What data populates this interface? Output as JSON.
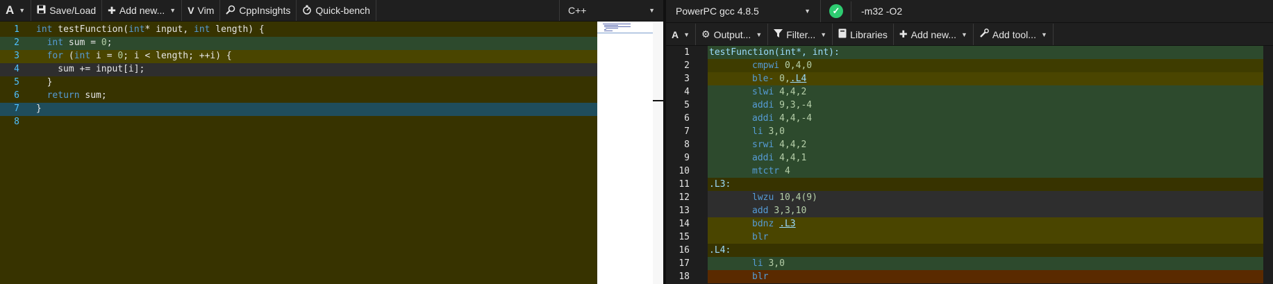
{
  "left_toolbar": {
    "font_label": "A",
    "save_label": "Save/Load",
    "add_new_label": "Add new...",
    "vim_label": "Vim",
    "cppinsights_label": "CppInsights",
    "quickbench_label": "Quick-bench",
    "language": "C++"
  },
  "source": {
    "lines": [
      {
        "n": "1",
        "bg": "#373300"
      },
      {
        "n": "2",
        "bg": "#2d4a2d"
      },
      {
        "n": "3",
        "bg": "#4a4500"
      },
      {
        "n": "4",
        "bg": "#2e2e2e"
      },
      {
        "n": "5",
        "bg": "#373300"
      },
      {
        "n": "6",
        "bg": "#373300"
      },
      {
        "n": "7",
        "bg": "#1f4d5c"
      },
      {
        "n": "8",
        "bg": "#373300"
      }
    ],
    "tokens": {
      "l1_kw1": "int",
      "l1_a": " testFunction(",
      "l1_kw2": "int",
      "l1_b": "* input, ",
      "l1_kw3": "int",
      "l1_c": " length) {",
      "l2_kw": "int",
      "l2_a": " sum = ",
      "l2_num": "0",
      "l2_b": ";",
      "l3_kw1": "for",
      "l3_a": " (",
      "l3_kw2": "int",
      "l3_b": " i = ",
      "l3_num": "0",
      "l3_c": "; i < length; ++i) {",
      "l4": "sum += input[i];",
      "l5": "}",
      "l6_kw": "return",
      "l6_a": " sum;",
      "l7": "}"
    }
  },
  "compiler": {
    "name": "PowerPC gcc 4.8.5",
    "options": "-m32 -O2"
  },
  "right_toolbar": {
    "font_label": "A",
    "output_label": "Output...",
    "filter_label": "Filter...",
    "libraries_label": "Libraries",
    "add_new_label": "Add new...",
    "add_tool_label": "Add tool..."
  },
  "assembly": [
    {
      "n": "1",
      "bg": "#2d4a2d",
      "kind": "func",
      "text": "testFunction(int*, int):"
    },
    {
      "n": "2",
      "bg": "#3e3c00",
      "kind": "ins",
      "op": "cmpwi",
      "args": "0,4,0"
    },
    {
      "n": "3",
      "bg": "#4a4500",
      "kind": "ins",
      "op": "ble-",
      "args": "0,",
      "link": ".L4"
    },
    {
      "n": "4",
      "bg": "#2d4a2d",
      "kind": "ins",
      "op": "slwi",
      "args": "4,4,2"
    },
    {
      "n": "5",
      "bg": "#2d4a2d",
      "kind": "ins",
      "op": "addi",
      "args": "9,3,-4"
    },
    {
      "n": "6",
      "bg": "#2d4a2d",
      "kind": "ins",
      "op": "addi",
      "args": "4,4,-4"
    },
    {
      "n": "7",
      "bg": "#2d4a2d",
      "kind": "ins",
      "op": "li",
      "args": "3,0"
    },
    {
      "n": "8",
      "bg": "#2d4a2d",
      "kind": "ins",
      "op": "srwi",
      "args": "4,4,2"
    },
    {
      "n": "9",
      "bg": "#2d4a2d",
      "kind": "ins",
      "op": "addi",
      "args": "4,4,1"
    },
    {
      "n": "10",
      "bg": "#2d4a2d",
      "kind": "ins",
      "op": "mtctr",
      "args": "4"
    },
    {
      "n": "11",
      "bg": "#373300",
      "kind": "label",
      "text": ".L3:"
    },
    {
      "n": "12",
      "bg": "#2e2e2e",
      "kind": "ins",
      "op": "lwzu",
      "args": "10,4(9)"
    },
    {
      "n": "13",
      "bg": "#2e2e2e",
      "kind": "ins",
      "op": "add",
      "args": "3,3,10"
    },
    {
      "n": "14",
      "bg": "#4a4500",
      "kind": "ins",
      "op": "bdnz",
      "args": "",
      "link": ".L3"
    },
    {
      "n": "15",
      "bg": "#4a4500",
      "kind": "ins",
      "op": "blr",
      "args": ""
    },
    {
      "n": "16",
      "bg": "#373300",
      "kind": "label",
      "text": ".L4:"
    },
    {
      "n": "17",
      "bg": "#2d4a2d",
      "kind": "ins",
      "op": "li",
      "args": "3,0"
    },
    {
      "n": "18",
      "bg": "#5a2a00",
      "kind": "ins",
      "op": "blr",
      "args": ""
    }
  ],
  "colors": {
    "success": "#2ecc71",
    "source_bg": "#373300",
    "gutter_number": "#4fc1ff"
  }
}
